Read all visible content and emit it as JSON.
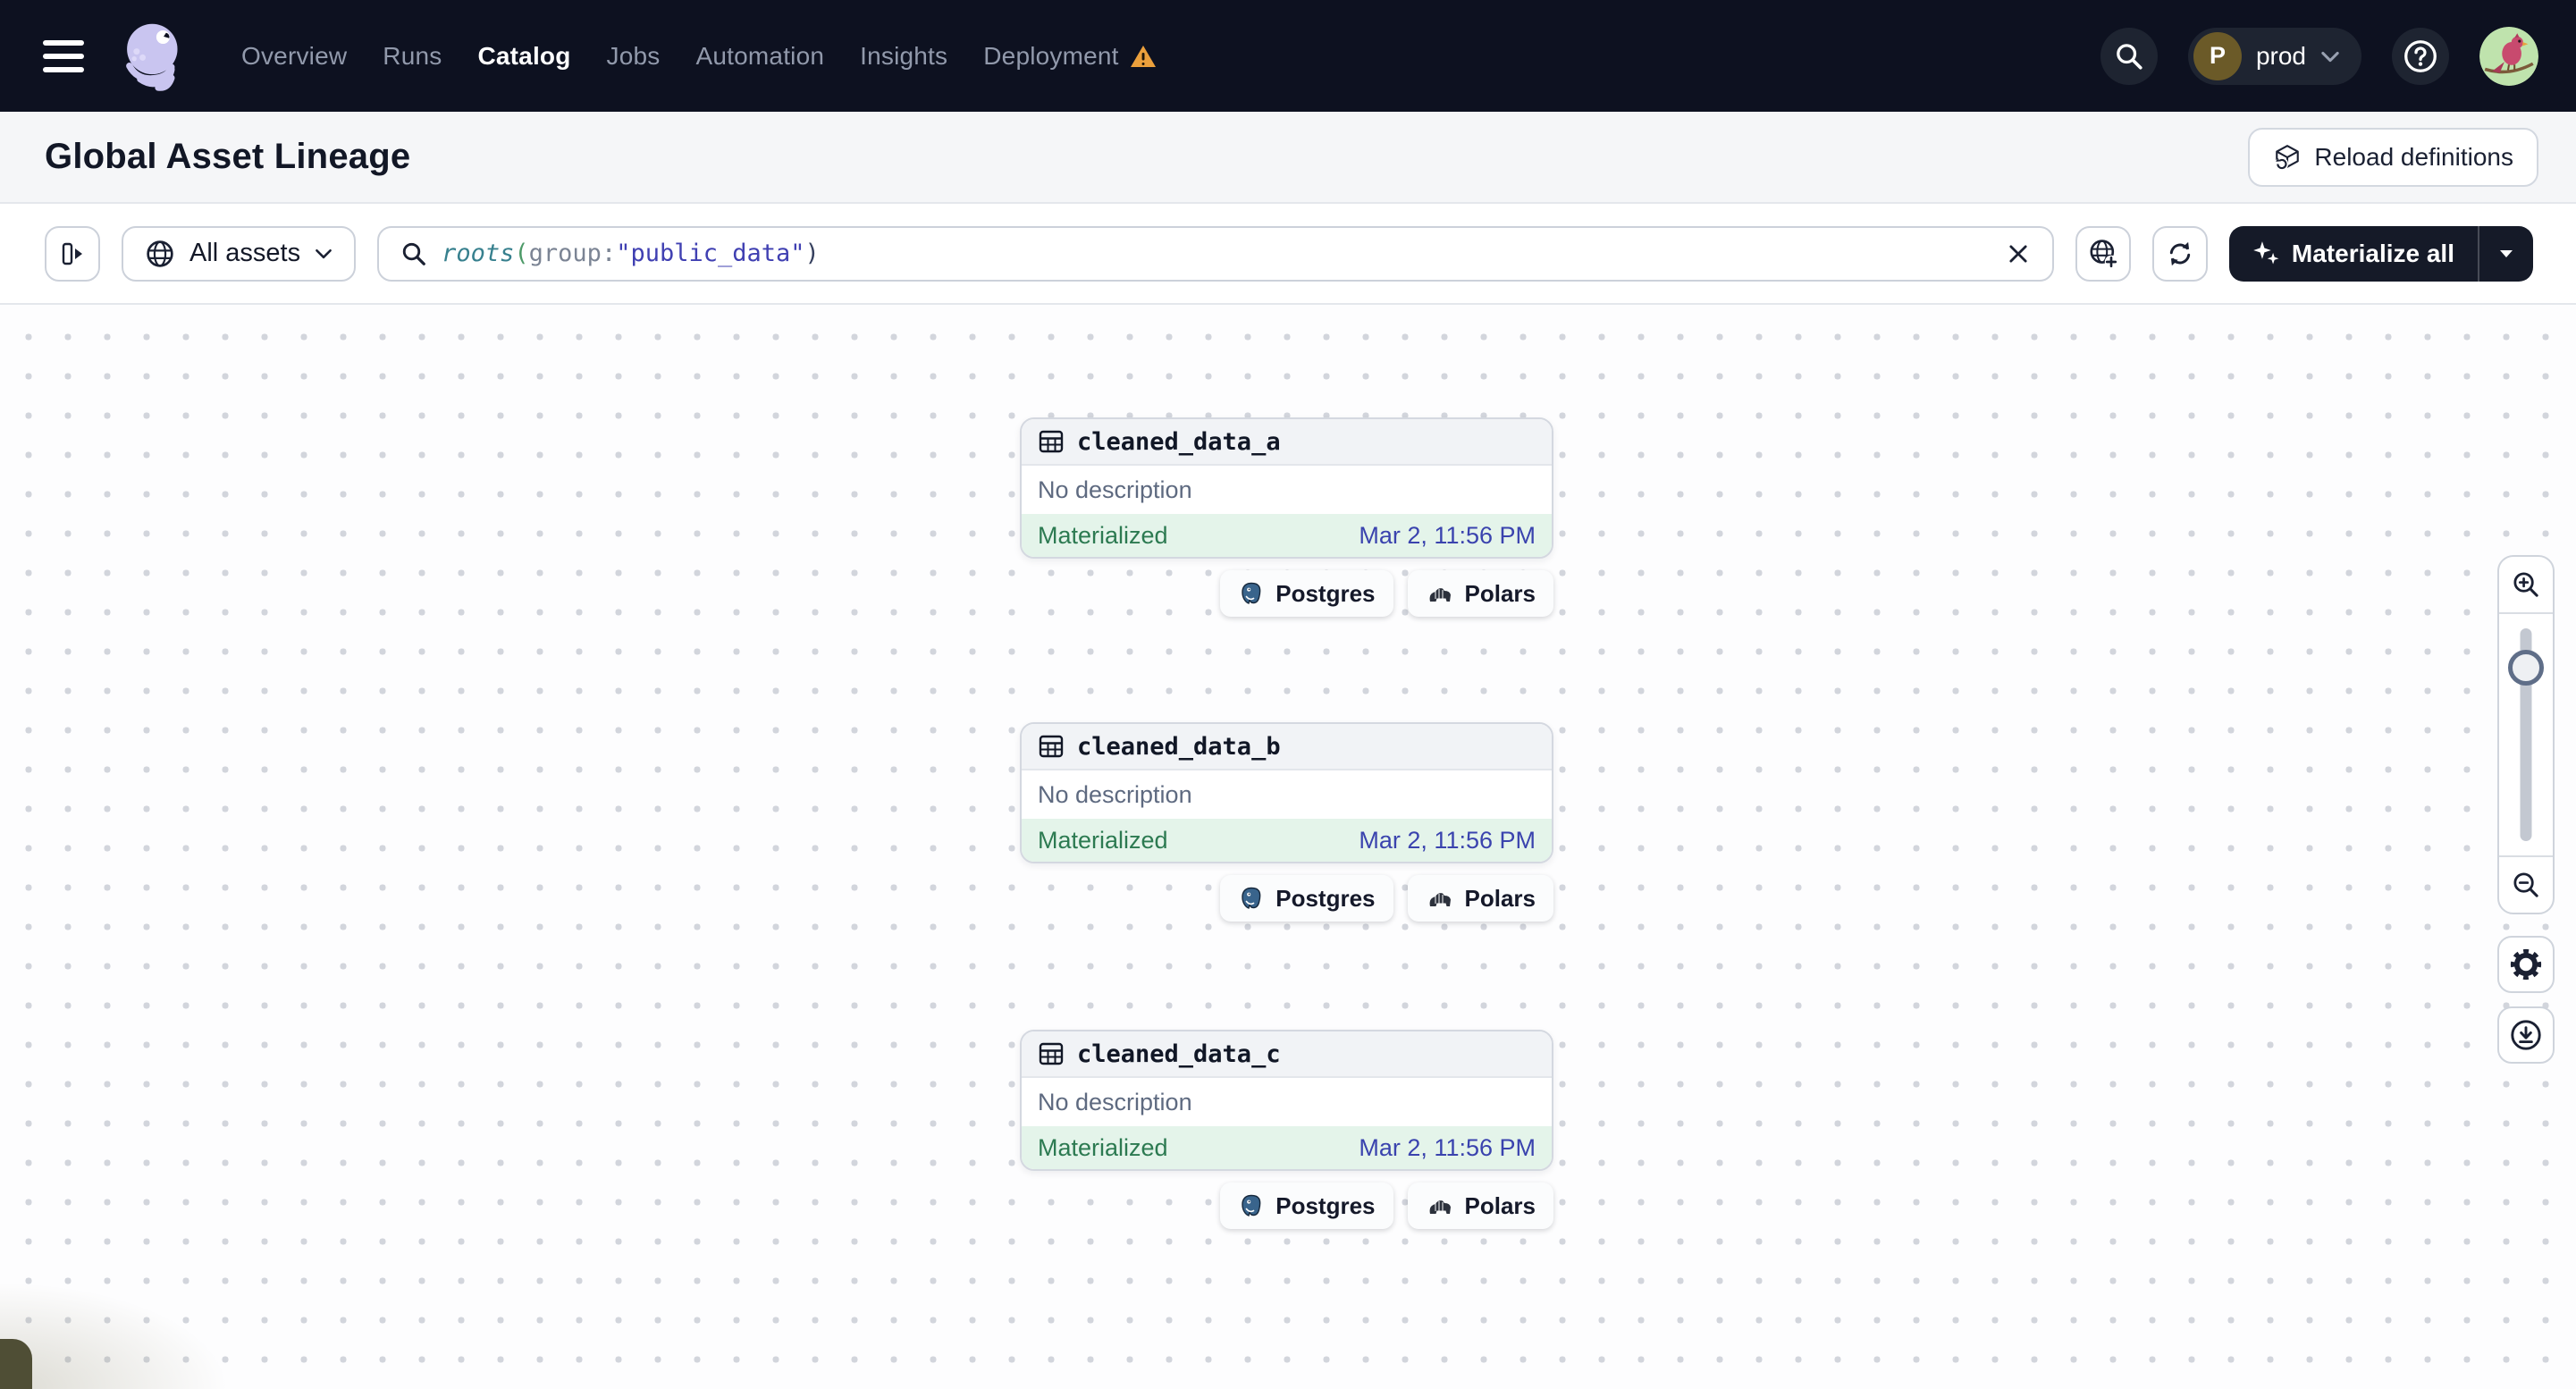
{
  "topbar": {
    "nav_items": [
      {
        "label": "Overview",
        "active": false
      },
      {
        "label": "Runs",
        "active": false
      },
      {
        "label": "Catalog",
        "active": true
      },
      {
        "label": "Jobs",
        "active": false
      },
      {
        "label": "Automation",
        "active": false
      },
      {
        "label": "Insights",
        "active": false
      },
      {
        "label": "Deployment",
        "active": false,
        "warning": true
      }
    ],
    "environment": {
      "initial": "P",
      "name": "prod"
    }
  },
  "header": {
    "title": "Global Asset Lineage",
    "reload_button_label": "Reload definitions"
  },
  "toolbar": {
    "scope_button_label": "All assets",
    "search": {
      "fn": "roots",
      "open_paren": "(",
      "key": "group",
      "colon": ":",
      "value": "\"public_data\"",
      "close_paren": ")"
    },
    "materialize_button_label": "Materialize all"
  },
  "canvas": {
    "assets": [
      {
        "name": "cleaned_data_a",
        "description": "No description",
        "status": "Materialized",
        "last_materialization": "Mar 2, 11:56 PM",
        "tags": [
          "Postgres",
          "Polars"
        ]
      },
      {
        "name": "cleaned_data_b",
        "description": "No description",
        "status": "Materialized",
        "last_materialization": "Mar 2, 11:56 PM",
        "tags": [
          "Postgres",
          "Polars"
        ]
      },
      {
        "name": "cleaned_data_c",
        "description": "No description",
        "status": "Materialized",
        "last_materialization": "Mar 2, 11:56 PM",
        "tags": [
          "Postgres",
          "Polars"
        ]
      }
    ]
  },
  "colors": {
    "topbar_bg": "#0d1120",
    "nav_inactive": "#9199ab",
    "warning_orange": "#eba03c",
    "status_green": "#2c7a51",
    "status_green_bg": "#e4f4ea",
    "timestamp_indigo": "#3a43ae",
    "materialize_bg": "#151a28",
    "postgres_blue": "#39648c",
    "query_function_teal": "#37808e",
    "query_string_indigo": "#4040b2"
  }
}
